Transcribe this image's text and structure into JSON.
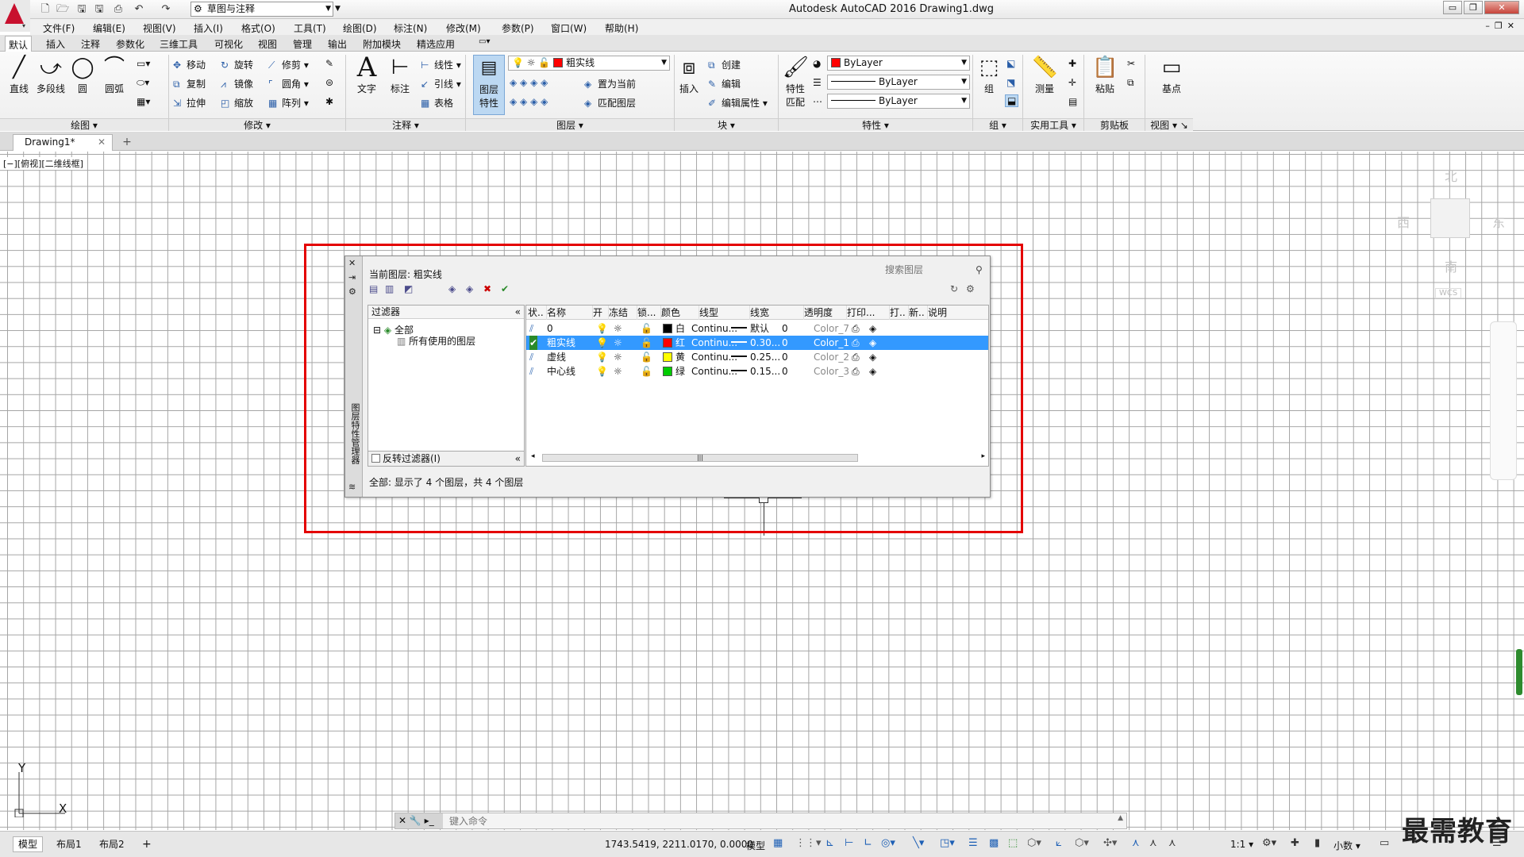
{
  "title_bar": {
    "workspace": "草图与注释",
    "title": "Autodesk AutoCAD 2016     Drawing1.dwg"
  },
  "menu": [
    "文件(F)",
    "编辑(E)",
    "视图(V)",
    "插入(I)",
    "格式(O)",
    "工具(T)",
    "绘图(D)",
    "标注(N)",
    "修改(M)",
    "参数(P)",
    "窗口(W)",
    "帮助(H)"
  ],
  "ribbon_tabs": [
    "默认",
    "插入",
    "注释",
    "参数化",
    "三维工具",
    "可视化",
    "视图",
    "管理",
    "输出",
    "附加模块",
    "精选应用"
  ],
  "ribbon": {
    "draw": {
      "line": "直线",
      "polyline": "多段线",
      "circle": "圆",
      "arc": "圆弧",
      "footer": "绘图"
    },
    "modify": {
      "move": "移动",
      "rotate": "旋转",
      "trim": "修剪",
      "copy": "复制",
      "mirror": "镜像",
      "fillet": "圆角",
      "stretch": "拉伸",
      "scale": "缩放",
      "array": "阵列",
      "footer": "修改"
    },
    "annotation": {
      "text": "文字",
      "dimension": "标注",
      "linear": "线性",
      "leader": "引线",
      "table": "表格",
      "footer": "注释"
    },
    "layers": {
      "properties_l1": "图层",
      "properties_l2": "特性",
      "current_layer": "粗实线",
      "set_current": "置为当前",
      "match_layer": "匹配图层",
      "footer": "图层"
    },
    "block": {
      "insert": "插入",
      "create": "创建",
      "edit": "编辑",
      "edit_attr": "编辑属性",
      "footer": "块"
    },
    "properties": {
      "match_l1": "特性",
      "match_l2": "匹配",
      "color": "ByLayer",
      "linetype": "ByLayer",
      "lineweight": "ByLayer",
      "footer": "特性"
    },
    "group": {
      "group": "组",
      "footer": "组"
    },
    "utilities": {
      "measure": "测量",
      "footer": "实用工具"
    },
    "clipboard": {
      "paste": "粘贴",
      "footer": "剪贴板"
    },
    "view": {
      "base": "基点",
      "footer": "视图"
    }
  },
  "doc_tab": "Drawing1*",
  "viewport_label": "[−][俯视][二维线框]",
  "viewcube": {
    "north": "北",
    "south": "南",
    "east": "东",
    "west": "西",
    "wcs": "WCS"
  },
  "ucs": {
    "y": "Y",
    "x": "X"
  },
  "layer_palette": {
    "vertical_title": "图层特性管理器",
    "current_layer": "当前图层: 粗实线",
    "search_placeholder": "搜索图层",
    "filters_header": "过滤器",
    "tree_all": "全部",
    "tree_used": "所有使用的图层",
    "invert_filter": "反转过滤器(I)",
    "status": "全部: 显示了 4 个图层，共 4 个图层",
    "columns": [
      "状..",
      "名称",
      "开",
      "冻结",
      "锁...",
      "颜色",
      "线型",
      "线宽",
      "透明度",
      "打印...",
      "打..",
      "新..",
      "说明"
    ],
    "layers": [
      {
        "name": "0",
        "color_name": "白",
        "color_hex": "#000000",
        "linetype": "Continu...",
        "lineweight": "默认",
        "transparency": "0",
        "plot_style": "Color_7",
        "current": false
      },
      {
        "name": "粗实线",
        "color_name": "红",
        "color_hex": "#ff0000",
        "linetype": "Continu...",
        "lineweight": "0.30...",
        "transparency": "0",
        "plot_style": "Color_1",
        "current": true
      },
      {
        "name": "虚线",
        "color_name": "黄",
        "color_hex": "#ffff00",
        "linetype": "Continu...",
        "lineweight": "0.25...",
        "transparency": "0",
        "plot_style": "Color_2",
        "current": false
      },
      {
        "name": "中心线",
        "color_name": "绿",
        "color_hex": "#00cc00",
        "linetype": "Continu...",
        "lineweight": "0.15...",
        "transparency": "0",
        "plot_style": "Color_3",
        "current": false
      }
    ]
  },
  "command_line": {
    "placeholder": "键入命令"
  },
  "status_bar": {
    "tabs": [
      "模型",
      "布局1",
      "布局2"
    ],
    "coords": "1743.5419, 2211.0170, 0.0000",
    "model": "模型",
    "scale": "1:1",
    "units": "小数"
  },
  "watermark": "最需教育",
  "colors": {
    "highlight": "#e40000",
    "selection": "#3399ff",
    "logo": "#c8102e"
  }
}
